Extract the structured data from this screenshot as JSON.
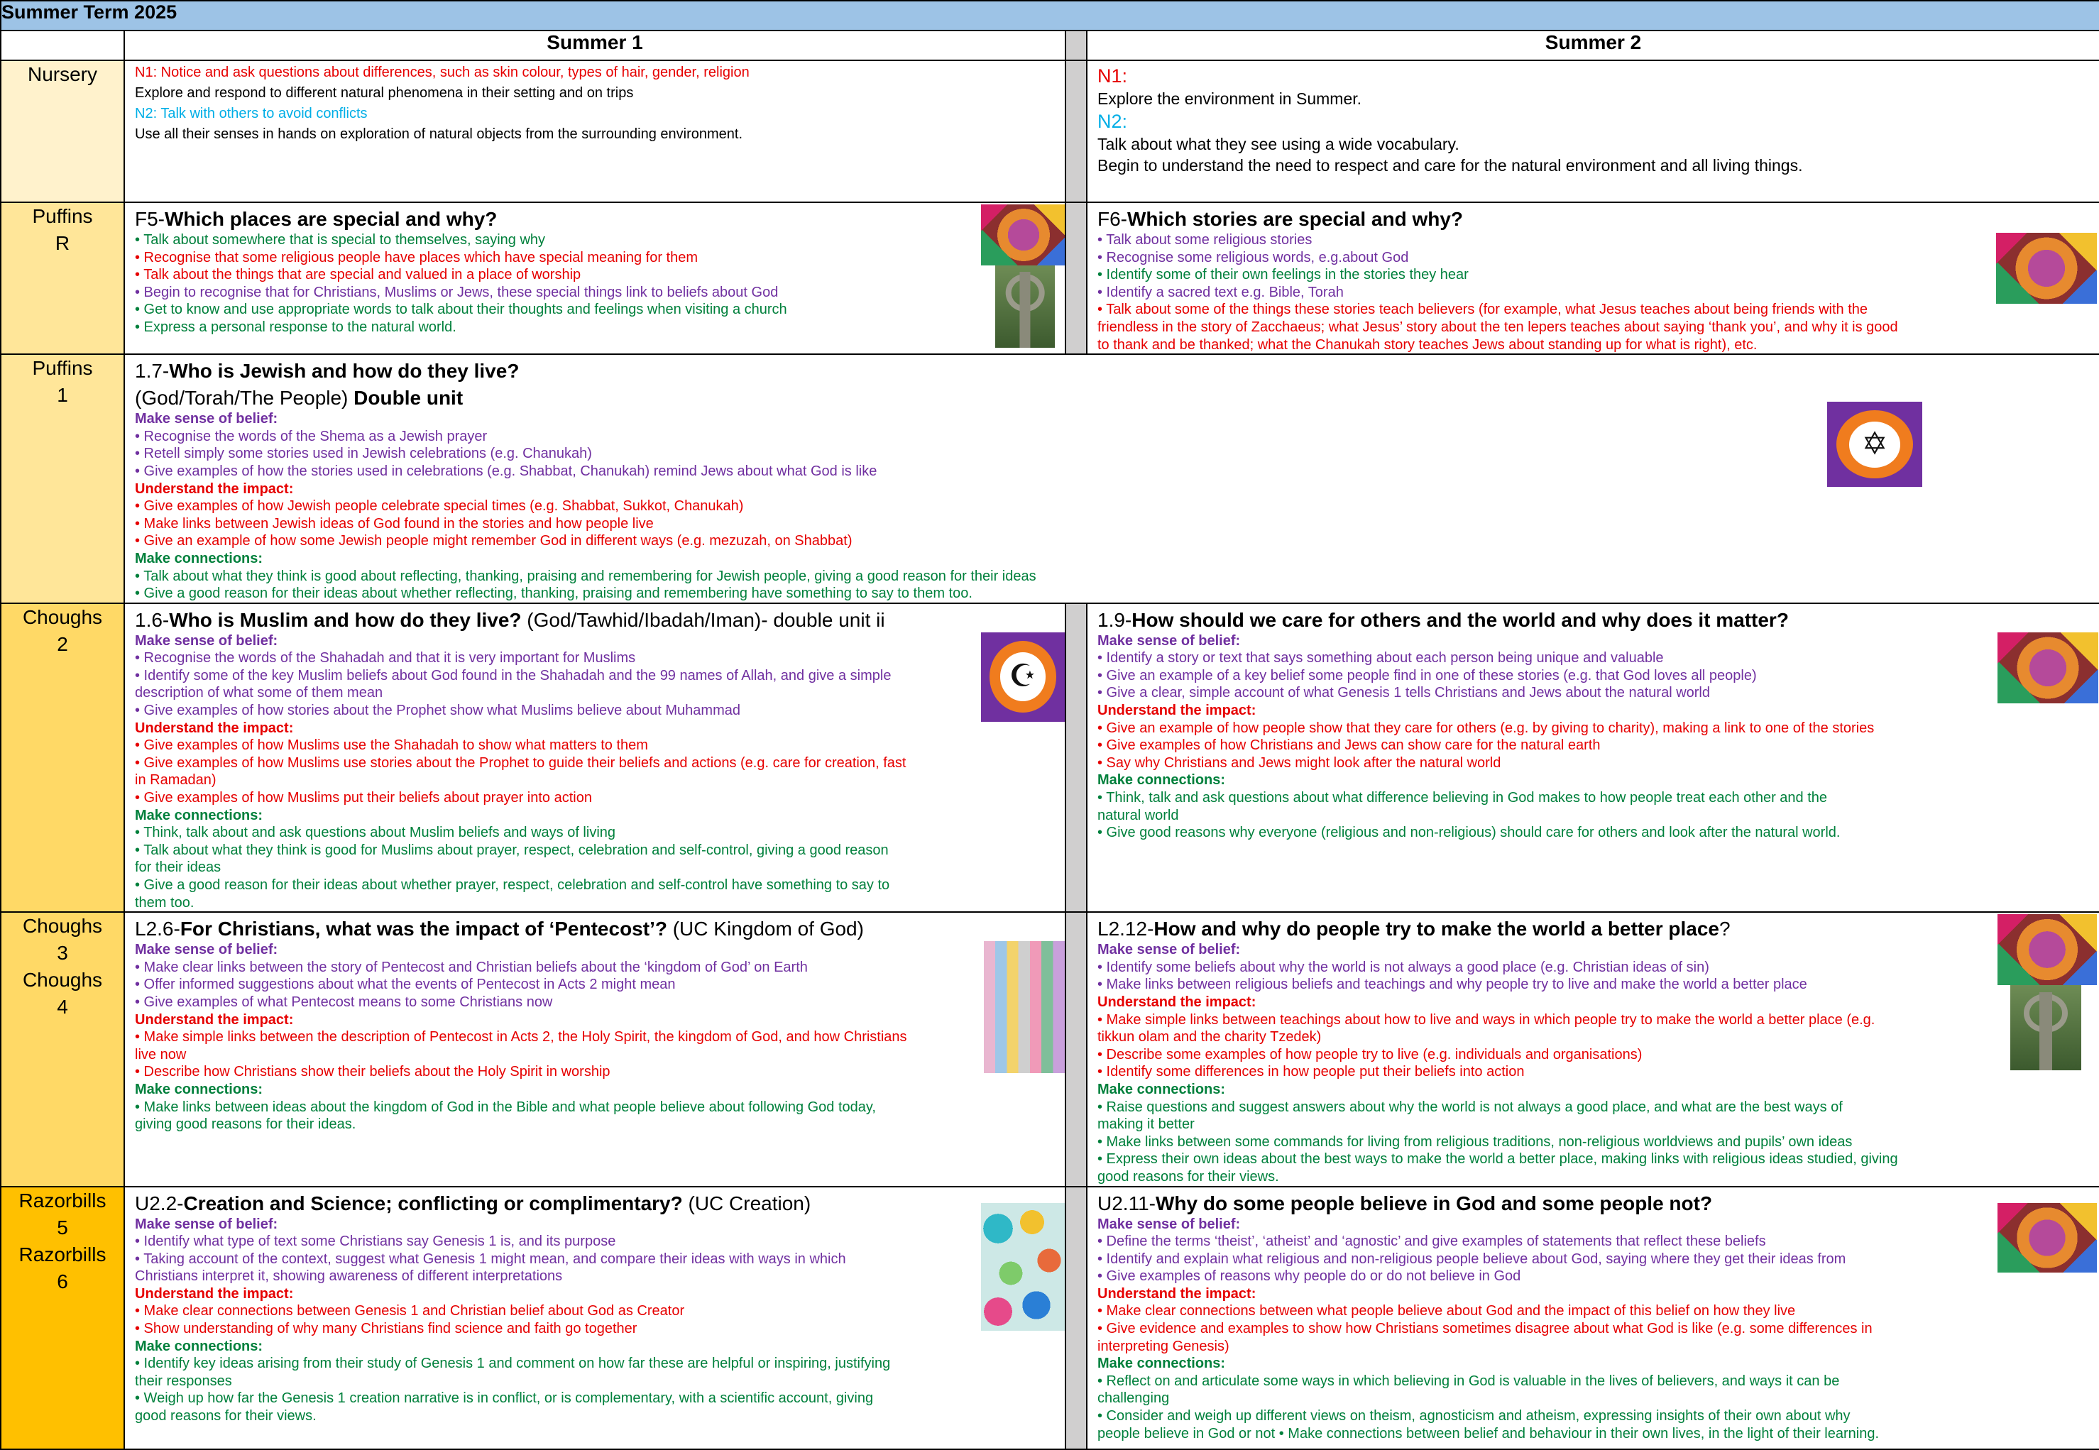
{
  "page_title": "Summer Term 2025",
  "columns": {
    "summer1": "Summer 1",
    "summer2": "Summer 2"
  },
  "nursery": {
    "label": "Nursery",
    "s1": [
      {
        "color": "red",
        "text": "N1: Notice and ask questions about differences, such as skin colour, types of hair, gender, religion"
      },
      {
        "color": "black",
        "text": "Explore and respond to different natural phenomena in their setting and on trips"
      },
      {
        "color": "blue",
        "text": "N2: Talk with others to avoid conflicts"
      },
      {
        "color": "black",
        "text": "Use all their senses in hands on exploration of natural objects from the surrounding environment."
      }
    ],
    "s2_n1": "N1:",
    "s2_l1": "Explore the environment in Summer.",
    "s2_n2": "N2:",
    "s2_l2": "Talk about what they see using a wide vocabulary.",
    "s2_l3": "Begin to understand the need to respect and care for the natural environment and all living things."
  },
  "puffinsR": {
    "label1": "Puffins",
    "label2": "R",
    "s1_code": "F5-",
    "s1_title": "Which places are special and why?",
    "s1_lines": [
      {
        "color": "green",
        "text": "• Talk about somewhere that is special to themselves, saying why"
      },
      {
        "color": "red",
        "text": "• Recognise that some religious people have places which have special meaning for them"
      },
      {
        "color": "red",
        "text": "• Talk about the things that are special and valued in a place of worship"
      },
      {
        "color": "purple",
        "text": "• Begin to recognise that for Christians, Muslims or Jews, these special things link to beliefs about God"
      },
      {
        "color": "green",
        "text": "• Get to know and use appropriate words to talk about their thoughts and feelings when visiting a church"
      },
      {
        "color": "green",
        "text": "• Express a personal response to the natural world."
      }
    ],
    "s2_code": "F6-",
    "s2_title": "Which stories are special and why?",
    "s2_lines": [
      {
        "color": "purple",
        "text": "• Talk about some religious stories"
      },
      {
        "color": "purple",
        "text": "• Recognise some religious words, e.g.about God"
      },
      {
        "color": "green",
        "text": "• Identify some of their own feelings in the stories they hear"
      },
      {
        "color": "purple",
        "text": "• Identify a sacred text e.g. Bible, Torah"
      },
      {
        "color": "red",
        "text": "• Talk about some of the things these stories teach believers (for example, what Jesus teaches about being friends with the"
      },
      {
        "color": "red",
        "text": "friendless in the story of Zacchaeus; what Jesus’ story about the ten lepers teaches about saying ‘thank you’, and why it is good"
      },
      {
        "color": "red",
        "text": "to thank and be thanked; what the Chanukah story teaches Jews about standing up for what is right), etc."
      }
    ]
  },
  "puffins1": {
    "label1": "Puffins",
    "label2": "1",
    "code": "1.7-",
    "title": "Who is Jewish and how do they live?",
    "sub_plain": "(God/Torah/The People) ",
    "sub_bold": "Double unit",
    "sec1": "Make sense of belief:",
    "l1": [
      "• Recognise the words of the Shema as a Jewish prayer",
      "• Retell simply some stories used in Jewish celebrations (e.g. Chanukah)",
      "• Give examples of how the stories used in celebrations (e.g. Shabbat, Chanukah) remind Jews about what God is like"
    ],
    "sec2": "Understand the impact:",
    "l2": [
      "• Give examples of how Jewish people celebrate special times (e.g. Shabbat, Sukkot, Chanukah)",
      "• Make links between Jewish ideas of God found in the stories and how people live",
      "• Give an example of how some Jewish people might remember God in different ways (e.g. mezuzah, on Shabbat)"
    ],
    "sec3": "Make connections:",
    "l3": [
      "• Talk about what they think is good about reflecting, thanking, praising and remembering for Jewish people, giving a good reason for their ideas",
      "• Give a good reason for their ideas about whether reflecting, thanking, praising and remembering have something to say to them too."
    ],
    "badge_symbol": "✡"
  },
  "choughs2": {
    "label1": "Choughs",
    "label2": "2",
    "s1_code": "1.6-",
    "s1_title": "Who is Muslim and how do they live?",
    "s1_sub": " (God/Tawhid/Ibadah/Iman)- double unit ii",
    "s1_sec1": "Make sense of belief:",
    "s1_l1": [
      "• Recognise the words of the Shahadah and that it is very important for Muslims",
      "• Identify some of the key Muslim beliefs about God found in the Shahadah and the 99 names of Allah, and give a simple",
      "description of what some of them mean",
      "• Give examples of how stories about the Prophet show what Muslims believe about Muhammad"
    ],
    "s1_sec2": "Understand the impact:",
    "s1_l2": [
      "• Give examples of how Muslims use the Shahadah to show what matters to them",
      "• Give examples of how Muslims use stories about the Prophet to guide their beliefs and actions (e.g. care for creation, fast",
      "in Ramadan)",
      "• Give examples of how Muslims put their beliefs about prayer into action"
    ],
    "s1_sec3": "Make connections:",
    "s1_l3": [
      "• Think, talk about and ask questions about Muslim beliefs and ways of living",
      "• Talk about what they think is good for Muslims about prayer, respect, celebration and self-control, giving a good reason",
      "for their ideas",
      "• Give a good reason for their ideas about whether prayer, respect, celebration and self-control have something to say to",
      "them too."
    ],
    "s1_badge_symbol": "☪",
    "s2_code": "1.9-",
    "s2_title": "How should we care for others and the world and why does it matter?",
    "s2_sec1": "Make sense of belief:",
    "s2_l1": [
      "• Identify a story or text that says something about each person being unique and valuable",
      "• Give an example of a key belief some people find in one of these stories (e.g. that God loves all people)",
      "• Give a clear, simple account of what Genesis 1 tells Christians and Jews about the natural world"
    ],
    "s2_sec2": "Understand the impact:",
    "s2_l2": [
      "• Give an example of how people show that they care for others (e.g. by giving to charity), making a link to one of the stories",
      "• Give examples of how Christians and Jews can show care for the natural earth",
      "• Say why Christians and Jews might look after the natural world"
    ],
    "s2_sec3": "Make connections:",
    "s2_l3": [
      "• Think, talk and ask questions about what difference believing in God makes to how people treat each other and the",
      "natural world",
      "• Give good reasons why everyone (religious and non-religious) should care for others and look after the natural world."
    ]
  },
  "choughs34": {
    "label1": "Choughs",
    "label2": "3",
    "label3": "Choughs",
    "label4": "4",
    "s1_code": "L2.6-",
    "s1_title": "For Christians, what was the impact of ‘Pentecost’?",
    "s1_sub": "  (UC Kingdom of God)",
    "s1_sec1": "Make sense of belief:",
    "s1_l1": [
      "• Make clear links between the story of Pentecost and Christian beliefs about the ‘kingdom of God’ on Earth",
      "• Offer informed suggestions about what the events of Pentecost in Acts 2 might mean",
      "• Give examples of what Pentecost means to some Christians now"
    ],
    "s1_sec2": "Understand the impact:",
    "s1_l2": [
      "• Make simple links between the description of Pentecost in Acts 2, the Holy Spirit, the kingdom of God, and how Christians",
      "live now",
      "• Describe how Christians show their beliefs about the Holy Spirit in worship"
    ],
    "s1_sec3": "Make connections:",
    "s1_l3": [
      "• Make links between ideas about the kingdom of God in the Bible and what people believe about following God today,",
      "giving good reasons for their ideas."
    ],
    "s2_code": "L2.12-",
    "s2_title": "How and why do people try to make the world a better place",
    "s2_q": "?",
    "s2_sec1": "Make sense of belief:",
    "s2_l1": [
      "• Identify some beliefs about why the world is not always a good place (e.g. Christian ideas of sin)",
      "• Make links between religious beliefs and teachings and why people try to live and make the world a better place"
    ],
    "s2_sec2": "Understand the impact:",
    "s2_l2": [
      "• Make simple links between teachings about how to live and ways in which people try to make the world a better place (e.g.",
      "tikkun olam and the charity Tzedek)",
      "• Describe some examples of how people try to live (e.g. individuals and organisations)",
      "• Identify some differences in how people put their beliefs into action"
    ],
    "s2_sec3": "Make connections:",
    "s2_l3": [
      "• Raise questions and suggest answers about why the world is not always a good place, and what are the best ways of",
      "making it better",
      "• Make links between some commands for living from religious traditions, non-religious worldviews and pupils’ own ideas",
      "• Express their own ideas about the best ways to make the world a better place, making links with religious ideas studied, giving",
      "good reasons for their views."
    ]
  },
  "razorbills": {
    "label1": "Razorbills",
    "label2": "5",
    "label3": "Razorbills",
    "label4": "6",
    "s1_code": "U2.2-",
    "s1_title": "Creation and Science; conflicting or complimentary?",
    "s1_sub": "  (UC Creation)",
    "s1_sec1": "Make sense of belief:",
    "s1_l1": [
      "• Identify what type of text some Christians say Genesis 1 is, and its purpose",
      "• Taking account of the context, suggest what Genesis 1 might mean, and compare their ideas with ways in which",
      "Christians interpret it, showing awareness of different interpretations"
    ],
    "s1_sec2": "Understand the impact:",
    "s1_l2": [
      "• Make clear connections between Genesis 1 and Christian belief about God as Creator",
      "• Show understanding of why many Christians find science and faith go together"
    ],
    "s1_sec3": "Make connections:",
    "s1_l3": [
      "• Identify key ideas arising from their study of Genesis 1 and comment on how far these are helpful or inspiring, justifying",
      "their responses",
      "• Weigh up how far the Genesis 1 creation narrative is in conflict, or is complementary, with a scientific account, giving",
      "good reasons for their views."
    ],
    "s2_code": "U2.11-",
    "s2_title": "Why do some people believe in God and some people not?",
    "s2_sec1": "Make sense of belief:",
    "s2_l1": [
      "• Define the terms ‘theist’, ‘atheist’ and ‘agnostic’ and give examples of statements that reflect these beliefs",
      "• Identify and explain what religious and non-religious people believe about God, saying where they get their ideas from",
      "• Give examples of reasons why people do or do not believe in God"
    ],
    "s2_sec2": "Understand the impact:",
    "s2_l2": [
      "• Make clear connections between what people believe about God and the impact of this belief on how they live",
      "• Give evidence and examples to show how Christians sometimes disagree about what God is like (e.g. some differences in",
      "interpreting Genesis)"
    ],
    "s2_sec3": "Make connections:",
    "s2_l3": [
      "• Reflect on and articulate some ways in which believing in God is valuable in the lives of believers, and ways it can be",
      "challenging",
      "• Consider and weigh up different views on theism, agnosticism and atheism, expressing insights of their own about why",
      "people believe in God or not        • Make connections between belief and behaviour in their own lives, in the light of their learning."
    ]
  },
  "colors": {
    "title_bar": "#9dc3e6",
    "nursery": "#fff2cc",
    "puffins": "#ffe699",
    "choughs": "#ffd966",
    "razorbills": "#ffc000",
    "separator": "#d0cfcf",
    "purple": "#7030a0",
    "red": "#e60000",
    "green": "#00803c",
    "blue": "#00aee6"
  }
}
